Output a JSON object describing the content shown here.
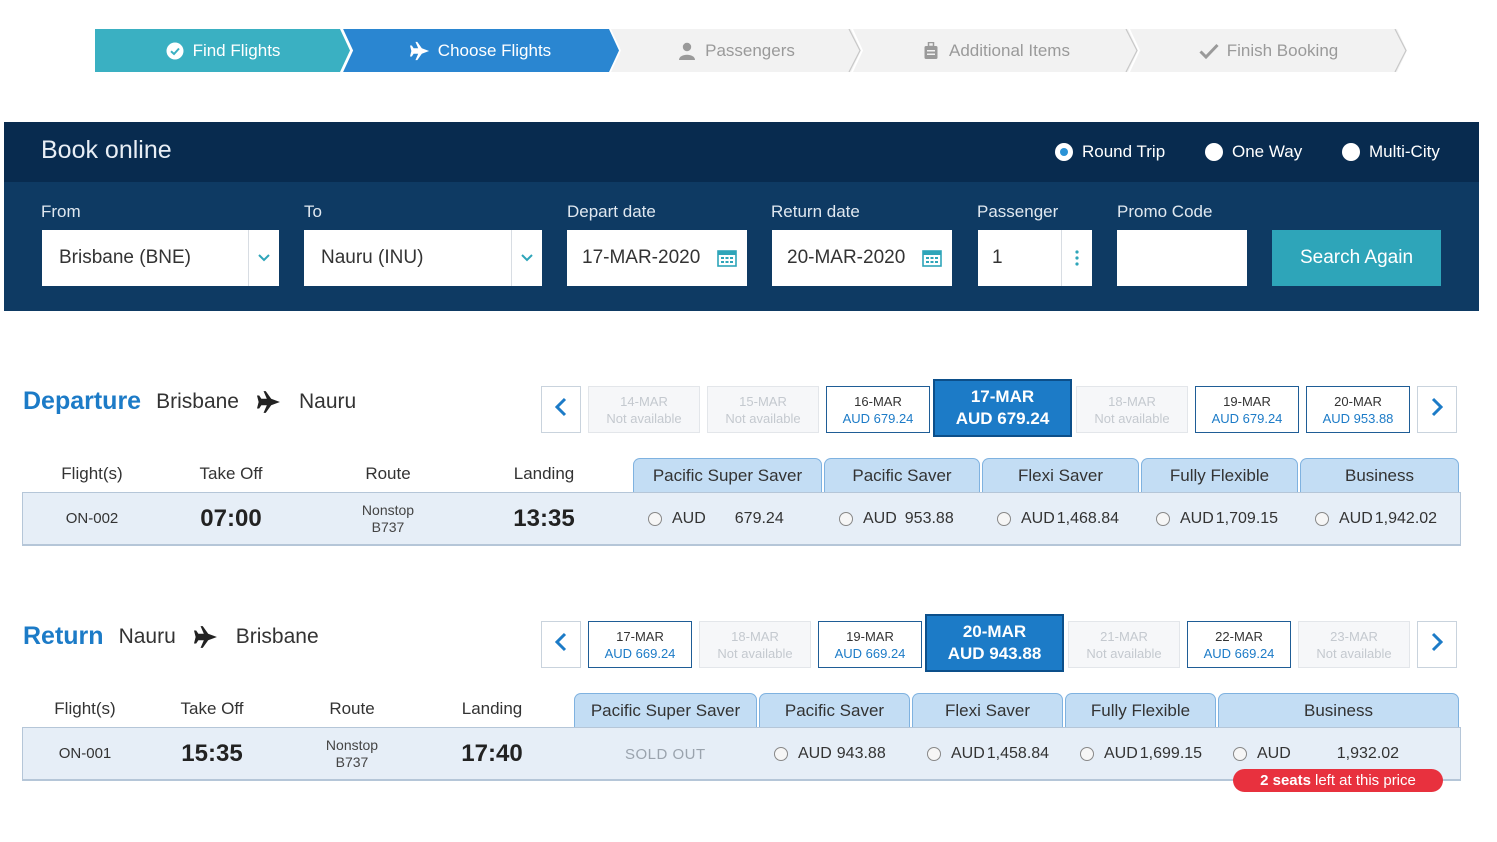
{
  "steps": [
    {
      "label": "Find Flights",
      "icon": "check-circle-icon",
      "state": "done"
    },
    {
      "label": "Choose Flights",
      "icon": "airplane-icon",
      "state": "active"
    },
    {
      "label": "Passengers",
      "icon": "person-icon",
      "state": "pending"
    },
    {
      "label": "Additional Items",
      "icon": "luggage-icon",
      "state": "pending"
    },
    {
      "label": "Finish Booking",
      "icon": "checkmark-icon",
      "state": "pending"
    }
  ],
  "colors": {
    "step_done": "#3ab0c2",
    "step_active": "#2a86d1",
    "step_pending": "#f2f2f2",
    "panel_bg": "#0e3a63",
    "panel_head": "#082b4f",
    "accent": "#1c7bc7",
    "search_button": "#2ea5b9",
    "seats_badge": "#e8313e"
  },
  "booking": {
    "title": "Book online",
    "trip_types": [
      {
        "label": "Round Trip",
        "selected": true
      },
      {
        "label": "One Way",
        "selected": false
      },
      {
        "label": "Multi-City",
        "selected": false
      }
    ],
    "from_label": "From",
    "from_value": "Brisbane (BNE)",
    "to_label": "To",
    "to_value": "Nauru (INU)",
    "depart_label": "Depart date",
    "depart_value": "17-MAR-2020",
    "return_label": "Return date",
    "return_value": "20-MAR-2020",
    "passenger_label": "Passenger",
    "passenger_value": "1",
    "promo_label": "Promo Code",
    "promo_value": "",
    "search_label": "Search Again"
  },
  "departure": {
    "title": "Departure",
    "from": "Brisbane",
    "to": "Nauru",
    "dates": [
      {
        "date": "14-MAR",
        "price": "Not available",
        "state": "na"
      },
      {
        "date": "15-MAR",
        "price": "Not available",
        "state": "na"
      },
      {
        "date": "16-MAR",
        "price": "AUD 679.24",
        "state": "avail"
      },
      {
        "date": "17-MAR",
        "price": "AUD 679.24",
        "state": "sel"
      },
      {
        "date": "18-MAR",
        "price": "Not available",
        "state": "na"
      },
      {
        "date": "19-MAR",
        "price": "AUD 679.24",
        "state": "avail"
      },
      {
        "date": "20-MAR",
        "price": "AUD 953.88",
        "state": "avail"
      }
    ],
    "columns": [
      "Flight(s)",
      "Take Off",
      "Route",
      "Landing"
    ],
    "fare_classes": [
      "Pacific Super Saver",
      "Pacific Saver",
      "Flexi Saver",
      "Fully Flexible",
      "Business"
    ],
    "flight": {
      "number": "ON-002",
      "takeoff": "07:00",
      "route_line1": "Nonstop",
      "route_line2": "B737",
      "landing": "13:35",
      "fares": [
        {
          "currency": "AUD",
          "amount": "679.24"
        },
        {
          "currency": "AUD",
          "amount": "953.88"
        },
        {
          "currency": "AUD",
          "amount": "1,468.84"
        },
        {
          "currency": "AUD",
          "amount": "1,709.15"
        },
        {
          "currency": "AUD",
          "amount": "1,942.02"
        }
      ]
    }
  },
  "return": {
    "title": "Return",
    "from": "Nauru",
    "to": "Brisbane",
    "dates": [
      {
        "date": "17-MAR",
        "price": "AUD 669.24",
        "state": "avail"
      },
      {
        "date": "18-MAR",
        "price": "Not available",
        "state": "na"
      },
      {
        "date": "19-MAR",
        "price": "AUD 669.24",
        "state": "avail"
      },
      {
        "date": "20-MAR",
        "price": "AUD 943.88",
        "state": "sel"
      },
      {
        "date": "21-MAR",
        "price": "Not available",
        "state": "na"
      },
      {
        "date": "22-MAR",
        "price": "AUD 669.24",
        "state": "avail"
      },
      {
        "date": "23-MAR",
        "price": "Not available",
        "state": "na"
      }
    ],
    "columns": [
      "Flight(s)",
      "Take Off",
      "Route",
      "Landing"
    ],
    "fare_classes": [
      "Pacific Super Saver",
      "Pacific Saver",
      "Flexi Saver",
      "Fully Flexible",
      "Business"
    ],
    "flight": {
      "number": "ON-001",
      "takeoff": "15:35",
      "route_line1": "Nonstop",
      "route_line2": "B737",
      "landing": "17:40",
      "sold_out": "SOLD OUT",
      "fares": [
        {
          "currency": "AUD",
          "amount": "943.88"
        },
        {
          "currency": "AUD",
          "amount": "1,458.84"
        },
        {
          "currency": "AUD",
          "amount": "1,699.15"
        },
        {
          "currency": "AUD",
          "amount": "1,932.02"
        }
      ],
      "seats_count": "2 seats",
      "seats_text": "left at this price"
    }
  }
}
